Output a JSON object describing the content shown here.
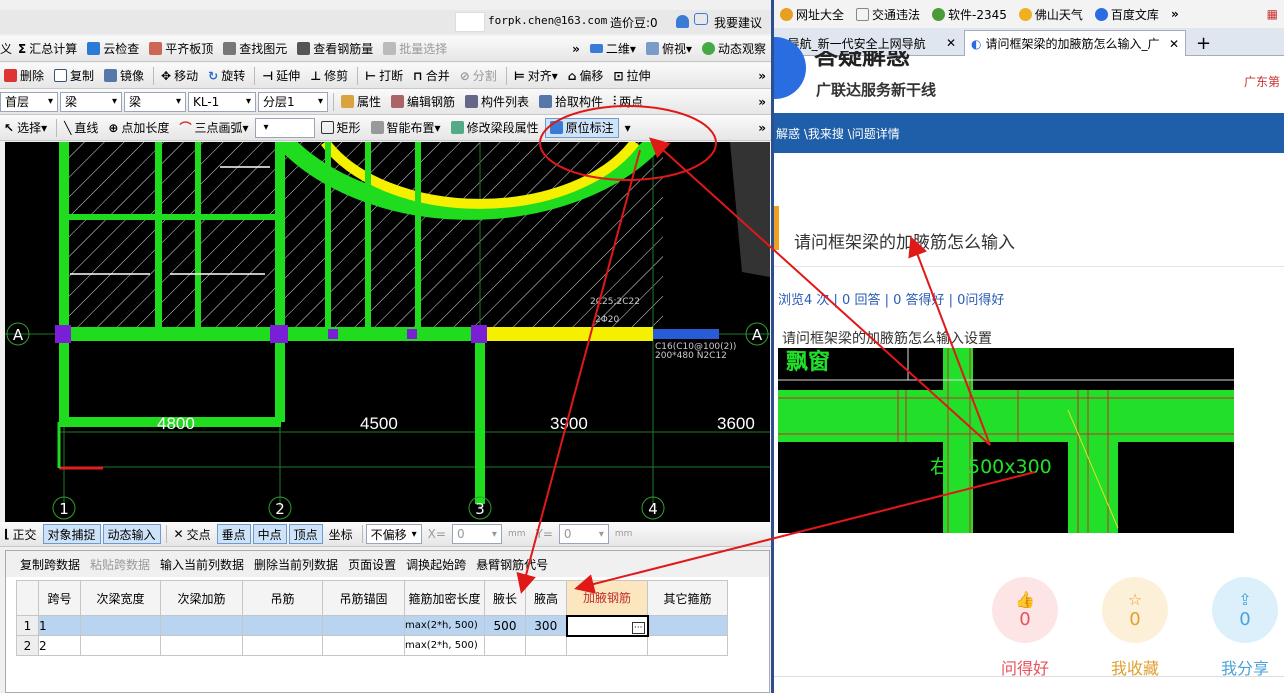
{
  "app": {
    "user": "forpk.chen@163.com",
    "price_label": "造价豆:0",
    "suggest": "我要建议",
    "row1": [
      "义",
      "汇总计算",
      "云检查",
      "平齐板顶",
      "查找图元",
      "查看钢筋量",
      "批量选择",
      "二维",
      "俯视",
      "动态观察"
    ],
    "row2": [
      "删除",
      "复制",
      "镜像",
      "移动",
      "旋转",
      "延伸",
      "修剪",
      "打断",
      "合并",
      "分割",
      "对齐",
      "偏移",
      "拉伸"
    ],
    "row3": {
      "floor": "首层",
      "cat1": "梁",
      "cat2": "梁",
      "comp": "KL-1",
      "layer": "分层1",
      "items": [
        "属性",
        "编辑钢筋",
        "构件列表",
        "拾取构件",
        "两点"
      ]
    },
    "row4": [
      "选择",
      "直线",
      "点加长度",
      "三点画弧",
      "矩形",
      "智能布置",
      "修改梁段属性",
      "原位标注"
    ],
    "canvas": {
      "axis_numbers": [
        "1",
        "2",
        "3",
        "4"
      ],
      "axis_letter": "A",
      "spans": [
        "4800",
        "4500",
        "3900",
        "3600"
      ],
      "labels": [
        "2Φ20",
        "C16(C10@100(2))",
        "200*480 N2C12",
        "2C25;2C22"
      ]
    },
    "status": {
      "items": [
        "正交",
        "对象捕捉",
        "动态输入",
        "交点",
        "垂点",
        "中点",
        "顶点",
        "坐标"
      ],
      "offset": "不偏移",
      "x_label": "X=",
      "x_val": "0",
      "y_label": "Y=",
      "y_val": "0",
      "unit": "mm"
    },
    "panel_toolbar": [
      "复制跨数据",
      "粘贴跨数据",
      "输入当前列数据",
      "删除当前列数据",
      "页面设置",
      "调换起始跨",
      "悬臂钢筋代号"
    ],
    "table": {
      "headers": [
        "跨号",
        "次梁宽度",
        "次梁加筋",
        "吊筋",
        "吊筋锚固",
        "箍筋加密长度",
        "腋长",
        "腋高",
        "加腋钢筋",
        "其它箍筋"
      ],
      "rows": [
        {
          "n": "1",
          "span": "1",
          "stirrup": "max(2*h, 500)",
          "ye_len": "500",
          "ye_h": "300"
        },
        {
          "n": "2",
          "span": "2",
          "stirrup": "max(2*h, 500)",
          "ye_len": "",
          "ye_h": ""
        }
      ]
    }
  },
  "browser": {
    "bookmarks": [
      "网址大全",
      "交通违法",
      "软件-2345",
      "佛山天气",
      "百度文库"
    ],
    "tabs": [
      "0导航_新一代安全上网导航",
      "请问框架梁的加腋筋怎么输入_广"
    ],
    "site_title": "答疑解惑",
    "site_sub": "广联达服务新干线",
    "site_region": "广东第",
    "breadcrumb": "解惑 \\我来搜 \\问题详情",
    "question": "请问框架梁的加腋筋怎么输入",
    "stats": "浏览4 次 | 0 回答 | 0 答得好 | 0问得好",
    "detail": "请问框架梁的加腋筋怎么输入设置",
    "img_text_tl": "飘窗",
    "img_text": "右腋500x300",
    "actions": [
      {
        "count": "0",
        "label": "问得好",
        "color": "#e8505b"
      },
      {
        "count": "0",
        "label": "我收藏",
        "color": "#e0a030"
      },
      {
        "count": "0",
        "label": "我分享",
        "color": "#4aa3d8"
      }
    ]
  }
}
